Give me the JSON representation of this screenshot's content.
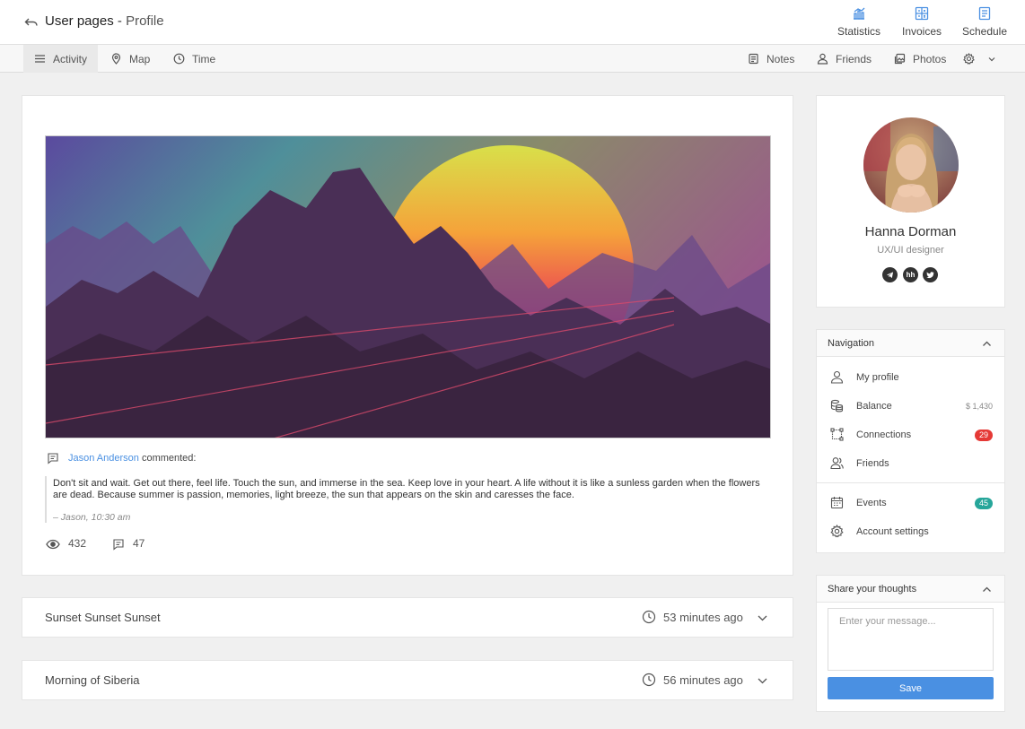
{
  "header": {
    "title": "User pages",
    "separator": " - ",
    "subtitle": "Profile",
    "buttons": [
      {
        "label": "Statistics",
        "icon": "chart-icon"
      },
      {
        "label": "Invoices",
        "icon": "calculator-icon"
      },
      {
        "label": "Schedule",
        "icon": "calendar-icon"
      }
    ]
  },
  "nav": {
    "left": [
      {
        "label": "Activity",
        "icon": "menu-icon",
        "active": true
      },
      {
        "label": "Map",
        "icon": "map-pin-icon"
      },
      {
        "label": "Time",
        "icon": "clock-icon"
      }
    ],
    "right": [
      {
        "label": "Notes",
        "icon": "notes-icon"
      },
      {
        "label": "Friends",
        "icon": "user-icon"
      },
      {
        "label": "Photos",
        "icon": "photos-icon"
      }
    ],
    "settings_icon": "gear-icon"
  },
  "post": {
    "comment_author": "Jason Anderson",
    "comment_action": " commented:",
    "quote": "Don't sit and wait. Get out there, feel life. Touch the sun, and immerse in the sea. Keep love in your heart. A life without it is like a sunless garden when the flowers are dead. Because summer is passion, memories, light breeze, the sun that appears on the skin and caresses the face.",
    "quote_author": "– Jason, 10:30 am",
    "views": "432",
    "comments": "47"
  },
  "rows": [
    {
      "title": "Sunset Sunset Sunset",
      "time": "53 minutes ago"
    },
    {
      "title": "Morning of Siberia",
      "time": "56 minutes ago"
    }
  ],
  "profile": {
    "name": "Hanna Dorman",
    "role": "UX/UI designer",
    "social": [
      {
        "icon": "telegram-icon",
        "glyph": ""
      },
      {
        "icon": "headhunter-icon",
        "glyph": "hh"
      },
      {
        "icon": "twitter-icon",
        "glyph": ""
      }
    ]
  },
  "navigation": {
    "title": "Navigation",
    "items": [
      {
        "label": "My profile",
        "icon": "user-icon"
      },
      {
        "label": "Balance",
        "icon": "coins-icon",
        "value": "$ 1,430"
      },
      {
        "label": "Connections",
        "icon": "connections-icon",
        "badge": "29",
        "badge_color": "#e53935"
      },
      {
        "label": "Friends",
        "icon": "users-icon"
      },
      {
        "label": "Events",
        "icon": "calendar-icon",
        "badge": "45",
        "badge_color": "#26a69a"
      },
      {
        "label": "Account settings",
        "icon": "gear-icon"
      }
    ]
  },
  "share": {
    "title": "Share your thoughts",
    "placeholder": "Enter your message...",
    "button": "Save"
  },
  "colors": {
    "accent": "#4a90e2",
    "badge_red": "#e53935",
    "badge_green": "#26a69a"
  }
}
